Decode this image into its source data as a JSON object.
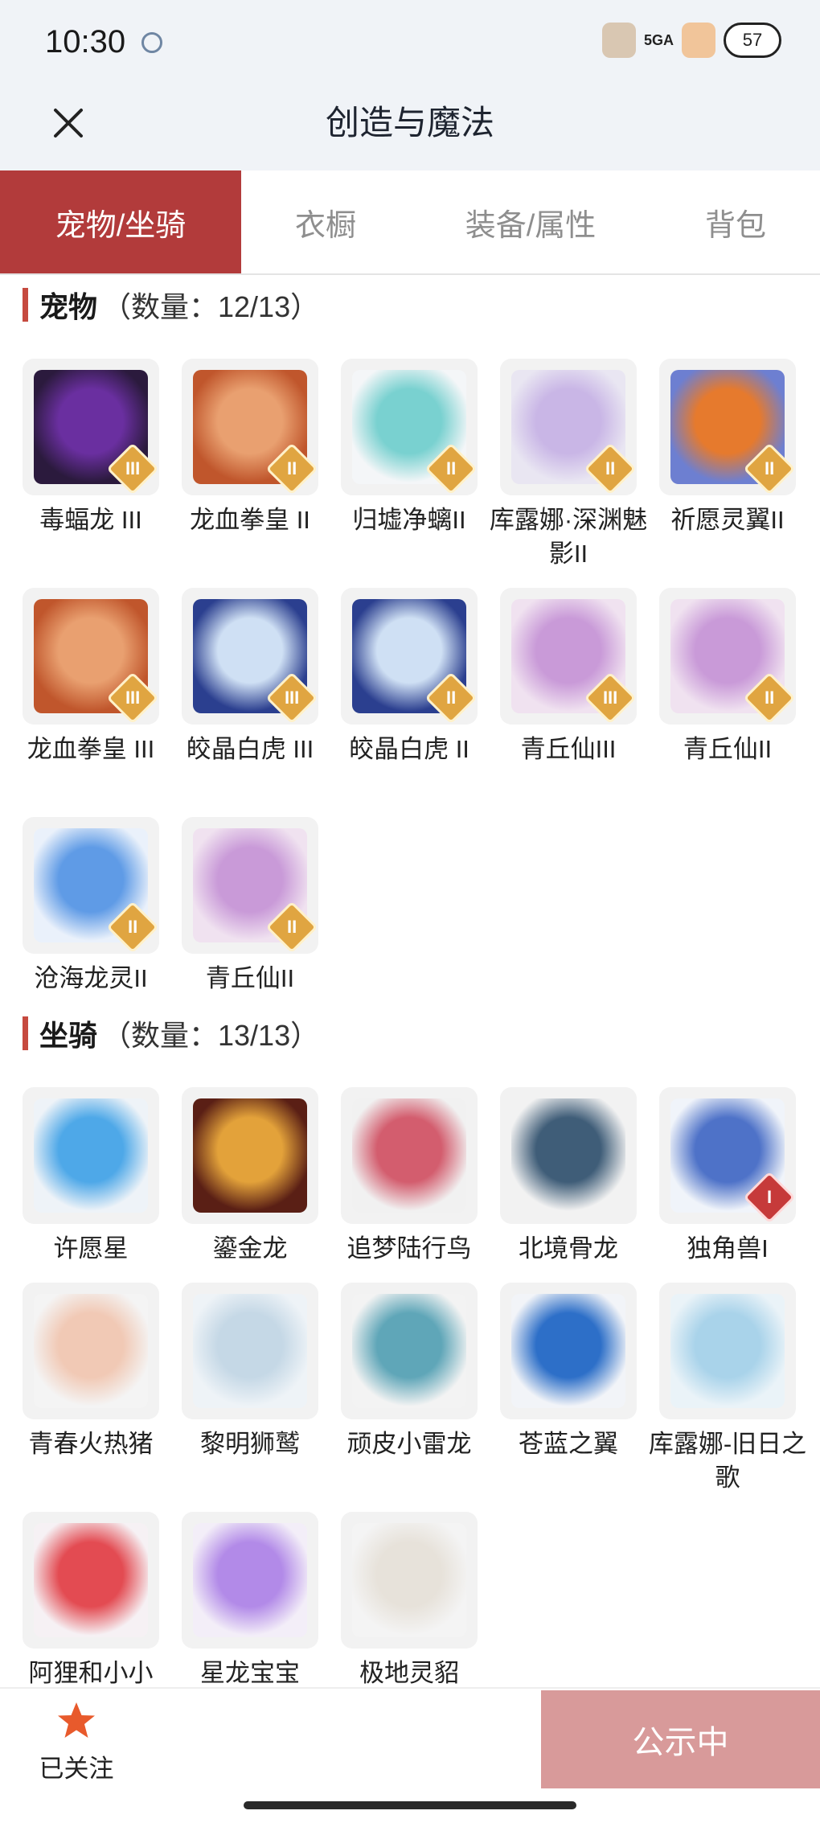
{
  "status": {
    "time": "10:30",
    "network": "5GA",
    "battery": "57"
  },
  "header": {
    "title": "创造与魔法"
  },
  "tabs": [
    {
      "label": "宠物/坐骑",
      "active": true
    },
    {
      "label": "衣橱",
      "active": false
    },
    {
      "label": "装备/属性",
      "active": false
    },
    {
      "label": "背包",
      "active": false
    }
  ],
  "pets": {
    "title": "宠物",
    "count": "（数量：12/13）",
    "items": [
      {
        "label": "毒蝠龙 III",
        "badge": "III",
        "icon": "purple-dragon"
      },
      {
        "label": "龙血拳皇 II",
        "badge": "II",
        "icon": "ram-beast"
      },
      {
        "label": "归墟净螭II",
        "badge": "II",
        "icon": "teal-dragon"
      },
      {
        "label": "库露娜·深渊魅影II",
        "badge": "II",
        "icon": "white-haired-girl"
      },
      {
        "label": "祈愿灵翼II",
        "badge": "II",
        "icon": "eagle"
      },
      {
        "label": "龙血拳皇 III",
        "badge": "III",
        "icon": "ram-beast"
      },
      {
        "label": "皎晶白虎 III",
        "badge": "III",
        "icon": "white-tiger"
      },
      {
        "label": "皎晶白虎 II",
        "badge": "II",
        "icon": "white-tiger"
      },
      {
        "label": "青丘仙III",
        "badge": "III",
        "icon": "fox-fairy"
      },
      {
        "label": "青丘仙II",
        "badge": "II",
        "icon": "fox-fairy"
      },
      {
        "label": "沧海龙灵II",
        "badge": "II",
        "icon": "blue-haired-boy"
      },
      {
        "label": "青丘仙II",
        "badge": "II",
        "icon": "fox-fairy"
      }
    ]
  },
  "mounts": {
    "title": "坐骑",
    "count": "（数量：13/13）",
    "items": [
      {
        "label": "许愿星",
        "badge": "",
        "icon": "blue-star"
      },
      {
        "label": "鎏金龙",
        "badge": "",
        "icon": "gold-dragon"
      },
      {
        "label": "追梦陆行鸟",
        "badge": "",
        "icon": "headphone-bird"
      },
      {
        "label": "北境骨龙",
        "badge": "",
        "icon": "bone-dragon"
      },
      {
        "label": "独角兽I",
        "badge": "I",
        "icon": "unicorn"
      },
      {
        "label": "青春火热猪",
        "badge": "",
        "icon": "pig"
      },
      {
        "label": "黎明狮鹫",
        "badge": "",
        "icon": "griffin"
      },
      {
        "label": "顽皮小雷龙",
        "badge": "",
        "icon": "green-dino"
      },
      {
        "label": "苍蓝之翼",
        "badge": "",
        "icon": "blue-bird"
      },
      {
        "label": "库露娜-旧日之歌",
        "badge": "",
        "icon": "sheep-girl"
      },
      {
        "label": "阿狸和小小",
        "badge": "",
        "icon": "ali-fox"
      },
      {
        "label": "星龙宝宝",
        "badge": "",
        "icon": "star-dragon-baby"
      },
      {
        "label": "极地灵貂",
        "badge": "",
        "icon": "snow-mink"
      }
    ]
  },
  "bottom": {
    "follow_label": "已关注",
    "public_label": "公示中"
  },
  "colors": {
    "accent": "#b23b3b",
    "section_bar": "#c64a3f",
    "public_button": "#d89a9a",
    "star": "#e85a2c"
  }
}
